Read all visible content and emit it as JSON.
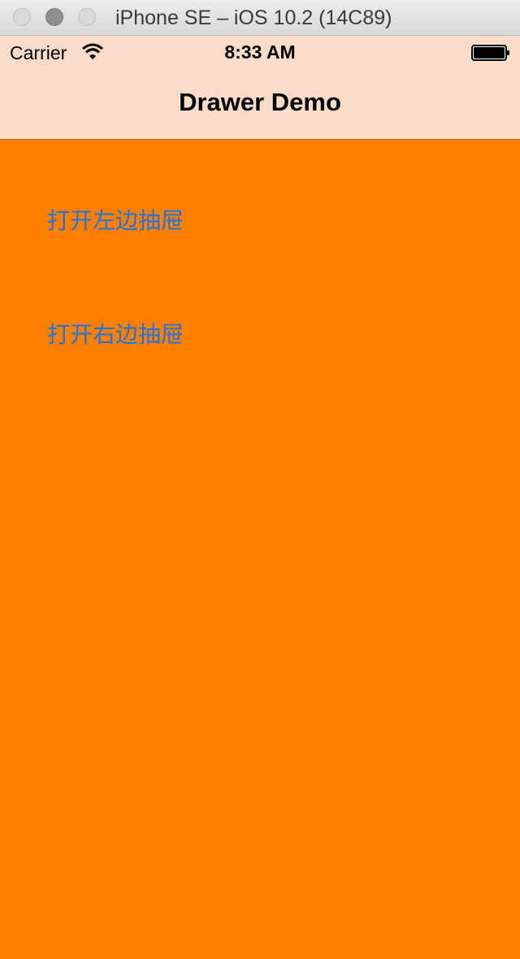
{
  "window": {
    "title": "iPhone SE – iOS 10.2 (14C89)"
  },
  "status_bar": {
    "carrier": "Carrier",
    "time": "8:33 AM",
    "icons": [
      "wifi-icon",
      "battery-icon"
    ]
  },
  "nav_bar": {
    "title": "Drawer Demo"
  },
  "content": {
    "buttons": [
      {
        "label": "打开左边抽屉"
      },
      {
        "label": "打开右边抽屉"
      }
    ]
  },
  "colors": {
    "content_background": "#ff7f00",
    "nav_background": "#f8dcc8",
    "button_text": "#1a76e3"
  }
}
